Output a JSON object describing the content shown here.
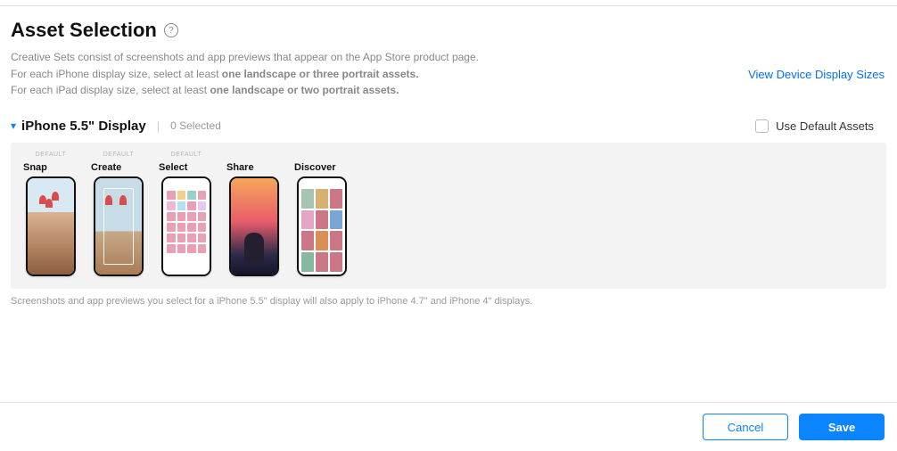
{
  "header": {
    "title": "Asset Selection",
    "help_tooltip": "?",
    "desc_line1_a": "Creative Sets consist of screenshots and app previews that appear on the App Store product page.",
    "desc_line2_a": "For each iPhone display size, select at least ",
    "desc_line2_b": "one landscape or three portrait assets.",
    "desc_line3_a": "For each iPad display size, select at least ",
    "desc_line3_b": "one landscape or two portrait assets.",
    "view_sizes_link": "View Device Display Sizes"
  },
  "section": {
    "title": "iPhone 5.5\" Display",
    "selected_count": "0 Selected",
    "use_default_label": "Use Default Assets",
    "default_badge": "DEFAULT",
    "assets": [
      {
        "title": "Snap",
        "is_default": true
      },
      {
        "title": "Create",
        "is_default": true
      },
      {
        "title": "Select",
        "is_default": true
      },
      {
        "title": "Share",
        "is_default": false
      },
      {
        "title": "Discover",
        "is_default": false
      }
    ],
    "note": "Screenshots and app previews you select for a iPhone 5.5\" display will also apply to iPhone 4.7\" and iPhone 4\" displays."
  },
  "footer": {
    "cancel_label": "Cancel",
    "save_label": "Save"
  }
}
